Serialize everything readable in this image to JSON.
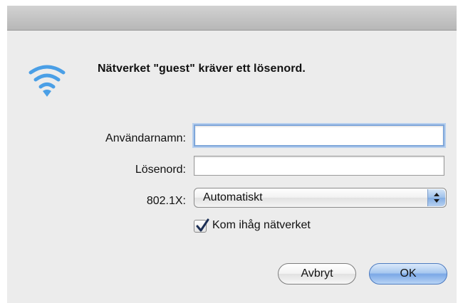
{
  "dialog": {
    "message": "Nätverket \"guest\" kräver ett lösenord.",
    "icon": "wifi-icon"
  },
  "form": {
    "username_label": "Användarnamn:",
    "username_value": "",
    "password_label": "Lösenord:",
    "password_value": "",
    "dot1x_label": "802.1X:",
    "dot1x_selected": "Automatiskt",
    "remember_label": "Kom ihåg nätverket",
    "remember_checked": true
  },
  "buttons": {
    "cancel_label": "Avbryt",
    "ok_label": "OK"
  },
  "colors": {
    "wifi": "#4a9fe6",
    "accent": "#7ba8e6",
    "focus_ring": "#7ea6da"
  }
}
